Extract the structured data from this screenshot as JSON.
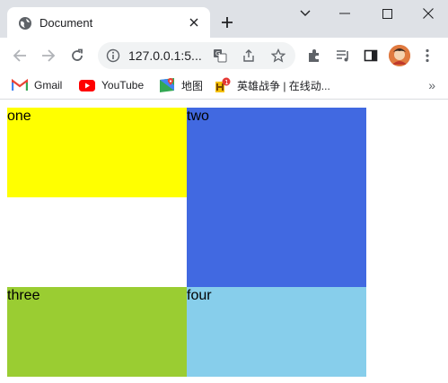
{
  "tab": {
    "title": "Document"
  },
  "toolbar": {
    "url": "127.0.0.1:5..."
  },
  "bookmarks": [
    {
      "label": "Gmail",
      "icon": "gmail-icon"
    },
    {
      "label": "YouTube",
      "icon": "youtube-icon"
    },
    {
      "label": "地图",
      "icon": "maps-icon"
    },
    {
      "label": "英雄战争 | 在线动...",
      "icon": "game-icon"
    }
  ],
  "page": {
    "boxes": [
      {
        "label": "one",
        "color": "#ffff00"
      },
      {
        "label": "two",
        "color": "#4169e1"
      },
      {
        "label": "three",
        "color": "#9acd32"
      },
      {
        "label": "four",
        "color": "#87ceeb"
      }
    ]
  },
  "colors": {
    "tabstrip": "#dee1e6",
    "omnibox": "#f1f3f4"
  }
}
